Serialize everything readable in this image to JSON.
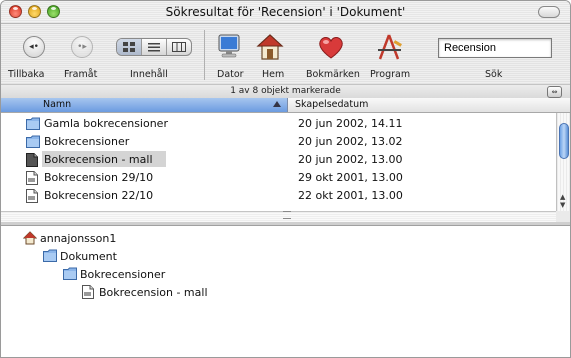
{
  "window": {
    "title": "Sökresultat för 'Recension' i 'Dokument'"
  },
  "toolbar": {
    "back_label": "Tillbaka",
    "forward_label": "Framåt",
    "view_label": "Innehåll",
    "computer_label": "Dator",
    "home_label": "Hem",
    "favorites_label": "Bokmärken",
    "applications_label": "Program",
    "search_label": "Sök",
    "search_value": "Recension"
  },
  "status": {
    "text": "1 av 8 objekt markerade"
  },
  "columns": {
    "name": "Namn",
    "date": "Skapelsedatum"
  },
  "rows": [
    {
      "name": "Gamla bokrecensioner",
      "date": "20 jun 2002, 14.11",
      "icon": "folder-icon",
      "selected": false
    },
    {
      "name": "Bokrecensioner",
      "date": "20 jun 2002, 13.02",
      "icon": "folder-icon",
      "selected": false
    },
    {
      "name": "Bokrecension - mall",
      "date": "20 jun 2002, 13.00",
      "icon": "template-document-icon",
      "selected": true
    },
    {
      "name": "Bokrecension 29/10",
      "date": "29 okt 2001, 13.00",
      "icon": "document-icon",
      "selected": false
    },
    {
      "name": "Bokrecension 22/10",
      "date": "22 okt 2001, 13.00",
      "icon": "document-icon",
      "selected": false
    }
  ],
  "path": [
    {
      "label": "annajonsson1",
      "icon": "home-icon"
    },
    {
      "label": "Dokument",
      "icon": "folder-icon"
    },
    {
      "label": "Bokrecensioner",
      "icon": "folder-icon"
    },
    {
      "label": "Bokrecension - mall",
      "icon": "template-document-icon"
    }
  ],
  "colors": {
    "header_highlight": "#8fb4ea",
    "selection": "#d4d4d4",
    "scroll_thumb": "#6fa3e6"
  }
}
